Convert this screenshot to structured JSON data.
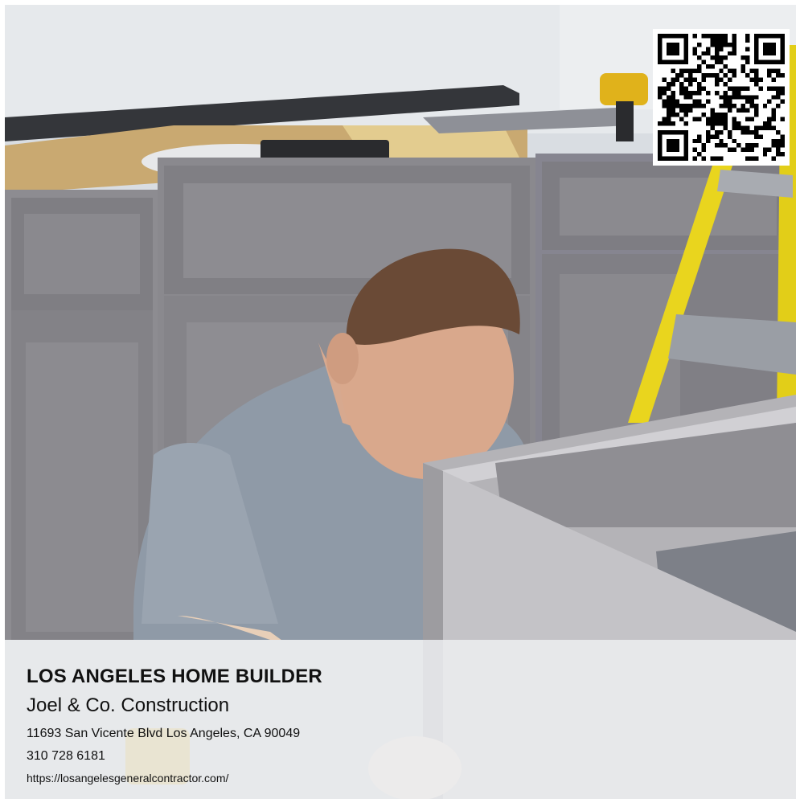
{
  "ad": {
    "headline": "LOS ANGELES HOME BUILDER",
    "company": "Joel & Co. Construction",
    "address": "11693 San Vicente Blvd Los Angeles, CA 90049",
    "phone": "310 728 6181",
    "website": "https://losangelesgeneralcontractor.com/"
  },
  "photo": {
    "subject": "worker installing gray kitchen cabinets",
    "colors": {
      "wall": "#e4e7ea",
      "cabinet": "#8b8a8e",
      "shirt": "#8f9aa6",
      "ladder": "#e8d41c",
      "countertop_edge": "#3a3c40"
    }
  },
  "qr_code": {
    "icon": "qr-code-icon"
  }
}
